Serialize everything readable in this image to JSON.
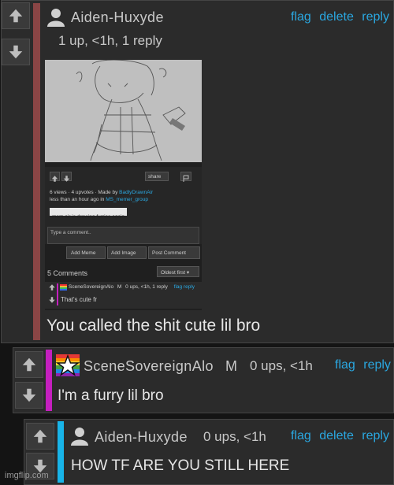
{
  "comment1": {
    "username": "Aiden-Huxyde",
    "meta": "1 up, <1h, 1 reply",
    "actions": [
      "flag",
      "delete",
      "reply"
    ],
    "text": "You called the shit cute lil bro",
    "stripe_color": "#8a4545"
  },
  "embedded": {
    "share_label": "share",
    "stats": "6 views · 4 upvotes · Made by",
    "made_by": "BadlyDrawnAir",
    "time": "less than an hour ago in",
    "stream": "MS_memer_group",
    "title_tag": "mom air is drawing furries again",
    "comment_placeholder": "Type a comment..",
    "buttons": [
      "Add Meme",
      "Add Image",
      "Post Comment"
    ],
    "comments_count": "5 Comments",
    "sort_label": "Oldest first",
    "sub_user": "SceneSovereignAlo",
    "sub_badge": "M",
    "sub_meta": "0 ups, <1h, 1 reply",
    "sub_actions": "flag reply",
    "sub_text": "That's cute fr"
  },
  "comment2": {
    "username": "SceneSovereignAlo",
    "badge": "M",
    "meta": "0 ups, <1h",
    "actions": [
      "flag",
      "reply"
    ],
    "text": "I'm a furry lil bro",
    "stripe_color": "#c51fbf"
  },
  "comment3": {
    "username": "Aiden-Huxyde",
    "meta": "0 ups, <1h",
    "actions": [
      "flag",
      "delete",
      "reply"
    ],
    "text": "HOW TF ARE YOU STILL HERE",
    "stripe_color": "#18b4e8"
  },
  "watermark": "imgflip.com"
}
